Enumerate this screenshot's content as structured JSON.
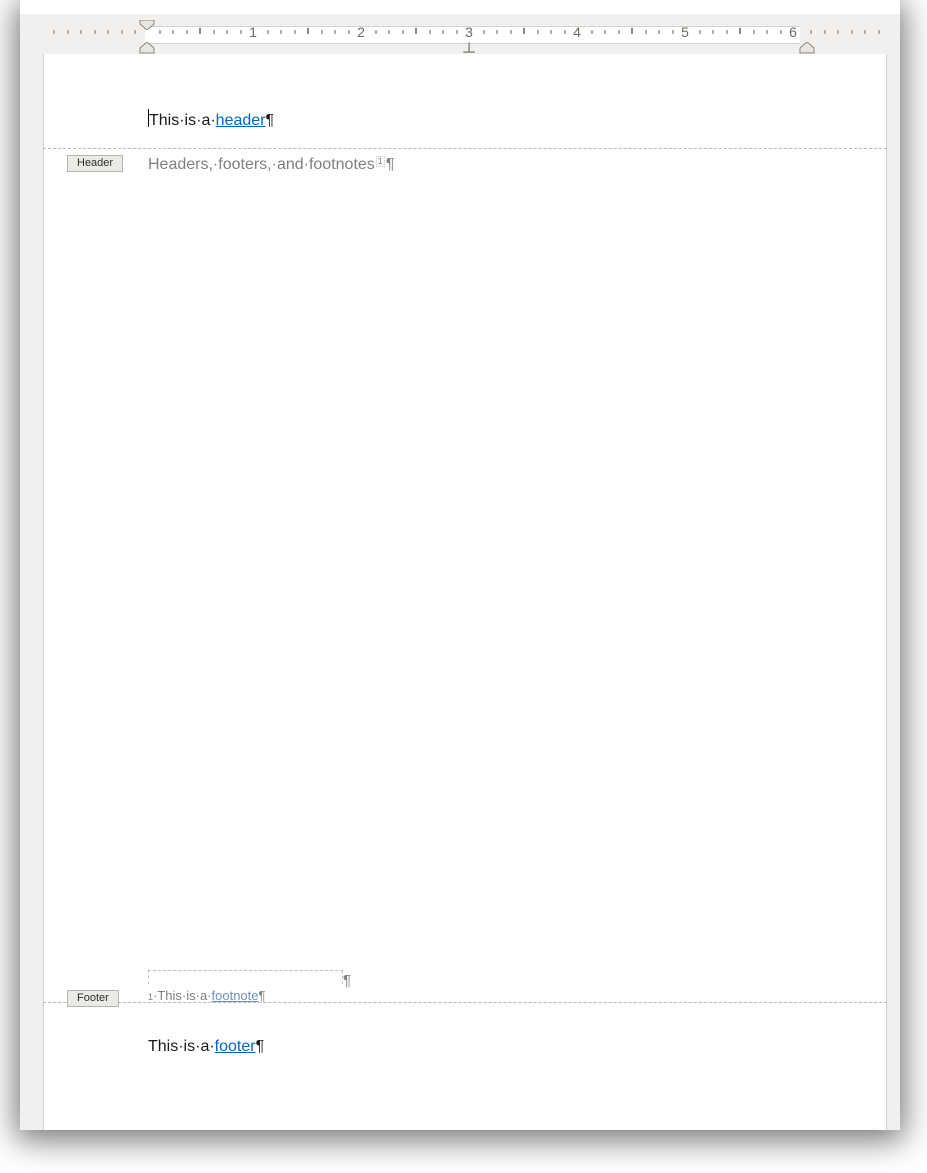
{
  "ruler": {
    "numbers": [
      "1",
      "2",
      "3",
      "4",
      "5",
      "6"
    ]
  },
  "tags": {
    "header": "Header",
    "footer": "Footer"
  },
  "header": {
    "prefix": "This·is·a·",
    "link": "header",
    "pilcrow": "¶"
  },
  "body": {
    "text": "Headers,·footers,·and·footnotes",
    "ref": "1",
    "pilcrow": "¶"
  },
  "footnote_sep_pilcrow": "¶",
  "footnote": {
    "sup": "1",
    "prefix": "·This·is·a·",
    "link": "footnote",
    "pilcrow": "¶"
  },
  "footer": {
    "prefix": "This·is·a·",
    "link": "footer",
    "pilcrow": "¶"
  }
}
